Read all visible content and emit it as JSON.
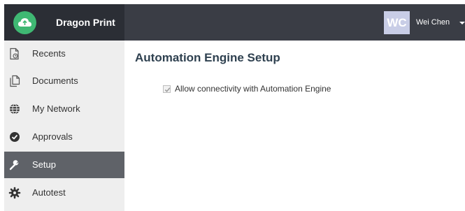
{
  "header": {
    "app_name": "Dragon Print",
    "logo_icon": "cloud-icon",
    "brand_color": "#3fb873",
    "user": {
      "initials": "WC",
      "name": "Wei Chen",
      "menu_icon": "caret-down-icon"
    }
  },
  "sidebar": {
    "active_color": "#5f6268",
    "items": [
      {
        "label": "Recents",
        "icon": "recent-file-icon",
        "active": false
      },
      {
        "label": "Documents",
        "icon": "documents-icon",
        "active": false
      },
      {
        "label": "My Network",
        "icon": "globe-icon",
        "active": false
      },
      {
        "label": "Approvals",
        "icon": "check-circle-icon",
        "active": false
      },
      {
        "label": "Setup",
        "icon": "wrench-icon",
        "active": true
      },
      {
        "label": "Autotest",
        "icon": "gear-icon",
        "active": false
      }
    ]
  },
  "main": {
    "title": "Automation Engine Setup",
    "option": {
      "label": "Allow connectivity with Automation Engine",
      "checked": true,
      "disabled": true
    }
  }
}
